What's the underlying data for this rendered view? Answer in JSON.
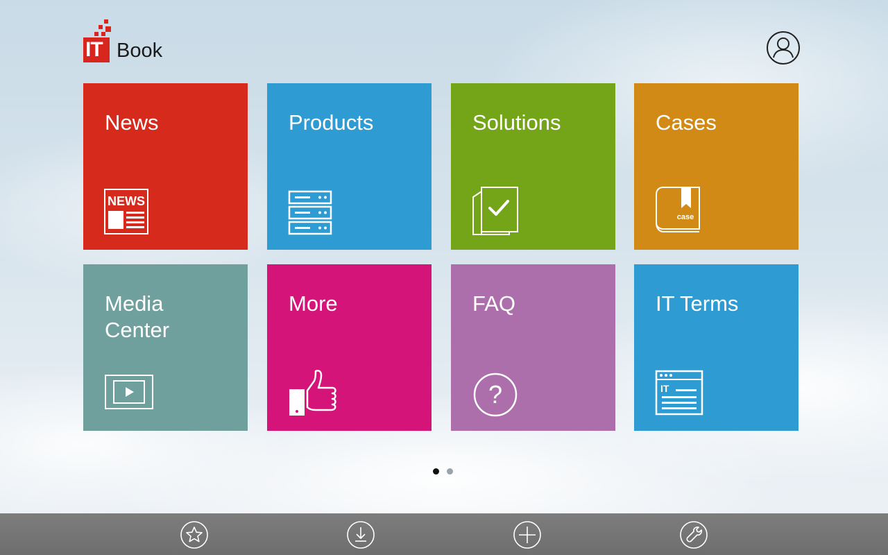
{
  "header": {
    "logo_mark": "IT",
    "logo_word": "Book",
    "brand_color": "#d7261e",
    "profile_icon": "user-icon"
  },
  "tiles": [
    {
      "label": "News",
      "color": "#d52a1c",
      "icon": "news-icon",
      "icon_text": "NEWS"
    },
    {
      "label": "Products",
      "color": "#2f9bd3",
      "icon": "server-icon"
    },
    {
      "label": "Solutions",
      "color": "#74a418",
      "icon": "document-check-icon"
    },
    {
      "label": "Cases",
      "color": "#d28a17",
      "icon": "case-book-icon",
      "icon_text": "case"
    },
    {
      "label": "Media\nCenter",
      "color": "#6fa09d",
      "icon": "video-play-icon"
    },
    {
      "label": "More",
      "color": "#d5147a",
      "icon": "thumbs-up-icon"
    },
    {
      "label": "FAQ",
      "color": "#ad6fac",
      "icon": "question-icon"
    },
    {
      "label": "IT Terms",
      "color": "#2f9bd3",
      "icon": "glossary-icon",
      "icon_text": "IT"
    }
  ],
  "pager": {
    "current": 1,
    "total": 2
  },
  "bottom_bar": [
    {
      "icon": "star-icon"
    },
    {
      "icon": "download-icon"
    },
    {
      "icon": "add-icon"
    },
    {
      "icon": "wrench-icon"
    }
  ]
}
